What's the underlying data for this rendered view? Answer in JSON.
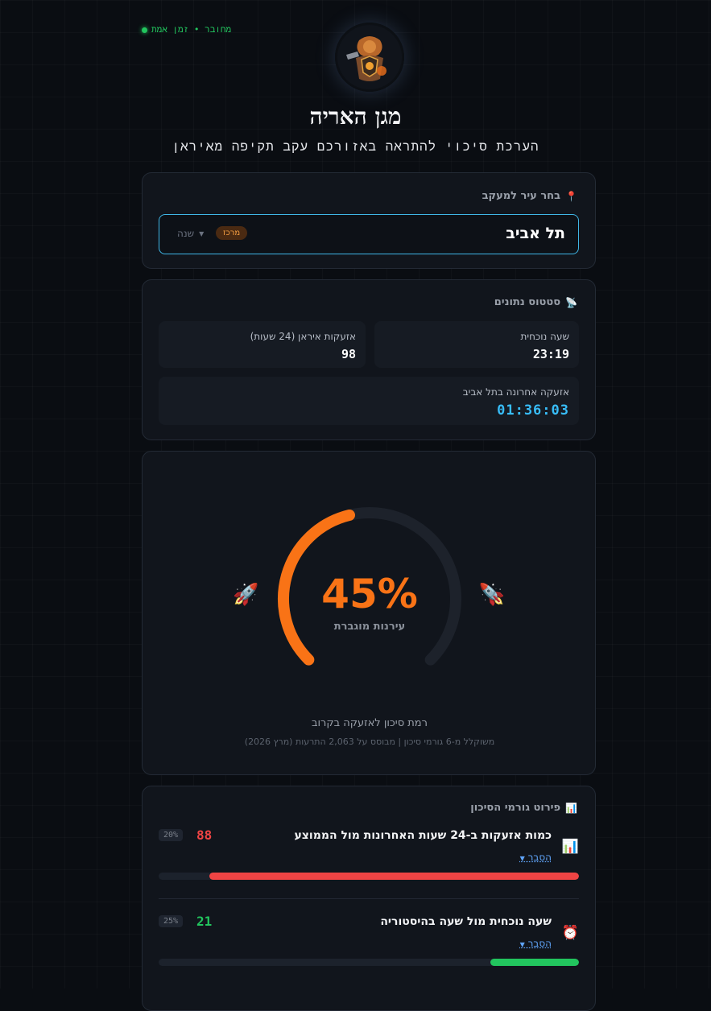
{
  "header": {
    "status_text": "מחובר • זמן אמת",
    "title": "מגן האריה",
    "subtitle": "הערכת סיכוי להתראה באזורכם עקב תקיפה מאיראן"
  },
  "city_card": {
    "title": "בחר עיר למעקב",
    "icon": "pin-icon",
    "selected_city": "תל אביב",
    "region_badge": "מרכז",
    "change_label": "שנה"
  },
  "status_card": {
    "title": "סטטוס נתונים",
    "icon": "satellite-icon",
    "current_time_label": "שעה נוכחית",
    "current_time_value": "23:19",
    "iran_alerts_label": "אזעקות איראן (24 שעות)",
    "iran_alerts_value": "98",
    "last_alert_label": "אזעקה אחרונה בתל אביב",
    "last_alert_value": "01:36:03"
  },
  "gauge": {
    "percent": 45,
    "percent_text": "45%",
    "level_label": "עירנות מוגברת",
    "risk_label": "רמת סיכון לאזעקה בקרוב",
    "risk_sub": "משוקלל מ-6 גורמי סיכון | מבוסס על 2,063 התרעות (מרץ 2026)",
    "color": "#f97316"
  },
  "factors_card": {
    "title": "פירוט גורמי הסיכון",
    "icon": "chart-icon",
    "explain_label": "הסבר",
    "items": [
      {
        "title": "כמות אזעקות ב-24 שעות האחרונות מול הממוצע",
        "icon": "bar-chart-icon",
        "score": "88",
        "score_value": 88,
        "weight": "20%",
        "color": "#ef4444"
      },
      {
        "title": "שעה נוכחית מול שעה בהיסטוריה",
        "icon": "alarm-clock-icon",
        "score": "21",
        "score_value": 21,
        "weight": "25%",
        "color": "#22c55e"
      }
    ]
  }
}
